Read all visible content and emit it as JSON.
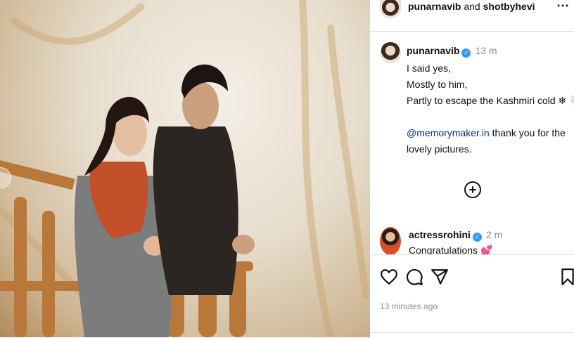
{
  "header": {
    "user1": "punarnavib",
    "connector": " and ",
    "user2": "shotbyhevi",
    "more_icon": "⋯"
  },
  "caption": {
    "username": "punarnavib",
    "verified_icon": "✓",
    "time": "13 m",
    "lines": [
      "I said yes,",
      "Mostly to him,",
      "Partly to escape the Kashmiri cold ❄ 🤍"
    ],
    "mention": "@memorymaker.in",
    "mention_rest": " thank you for the",
    "last_line": "lovely pictures."
  },
  "load_more_icon": "+",
  "comment": {
    "username": "actressrohini",
    "time": "2 m",
    "text": "Congratulations 💕"
  },
  "actions": {
    "like_icon": "heart-icon",
    "comment_icon": "comment-icon",
    "share_icon": "share-icon",
    "save_icon": "bookmark-icon"
  },
  "date": "13 minutes ago",
  "colors": {
    "verified": "#3897f0",
    "mention": "#00376b",
    "muted": "#8e8e8e",
    "divider": "#dbdbdb"
  }
}
